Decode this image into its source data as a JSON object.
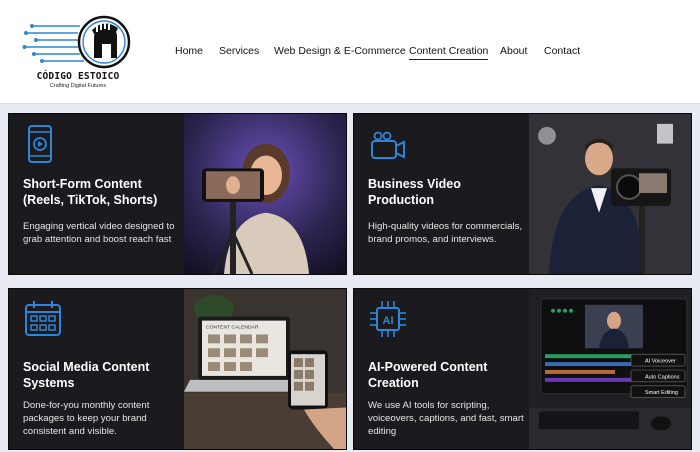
{
  "brand": {
    "name": "CÓDIGO ESTOICO",
    "tagline": "Crafting Digital Futures"
  },
  "nav": {
    "items": [
      "Home",
      "Services",
      "Web Design & E-Commerce",
      "Content Creation",
      "About",
      "Contact"
    ],
    "active": "Content Creation"
  },
  "colors": {
    "accent_blue": "#2f86d6",
    "card_bg": "#1b1b1f",
    "page_bg": "#e8ebf3"
  },
  "cards": [
    {
      "icon": "smartphone-play-icon",
      "title": "Short-Form Content (Reels, TikTok, Shorts)",
      "description": "Engaging vertical video designed to grab attention and boost reach fast"
    },
    {
      "icon": "video-camera-icon",
      "title": "Business Video Production",
      "description": "High-quality videos for commercials, brand promos, and interviews."
    },
    {
      "icon": "calendar-icon",
      "title": "Social Media Content Systems",
      "description": "Done-for-you monthly content packages to keep your brand consistent and visible."
    },
    {
      "icon": "ai-chip-icon",
      "title": "AI-Powered Content Creation",
      "description": "We use AI tools for scripting, voiceovers, captions, and fast, smart editing",
      "photo_labels": [
        "AI Voiceover",
        "Auto Captions",
        "Smart Editing"
      ],
      "photo_screen_text": "CONTENT CALENDAR"
    }
  ],
  "photo3_screen_text": "CONTENT CALENDAR"
}
